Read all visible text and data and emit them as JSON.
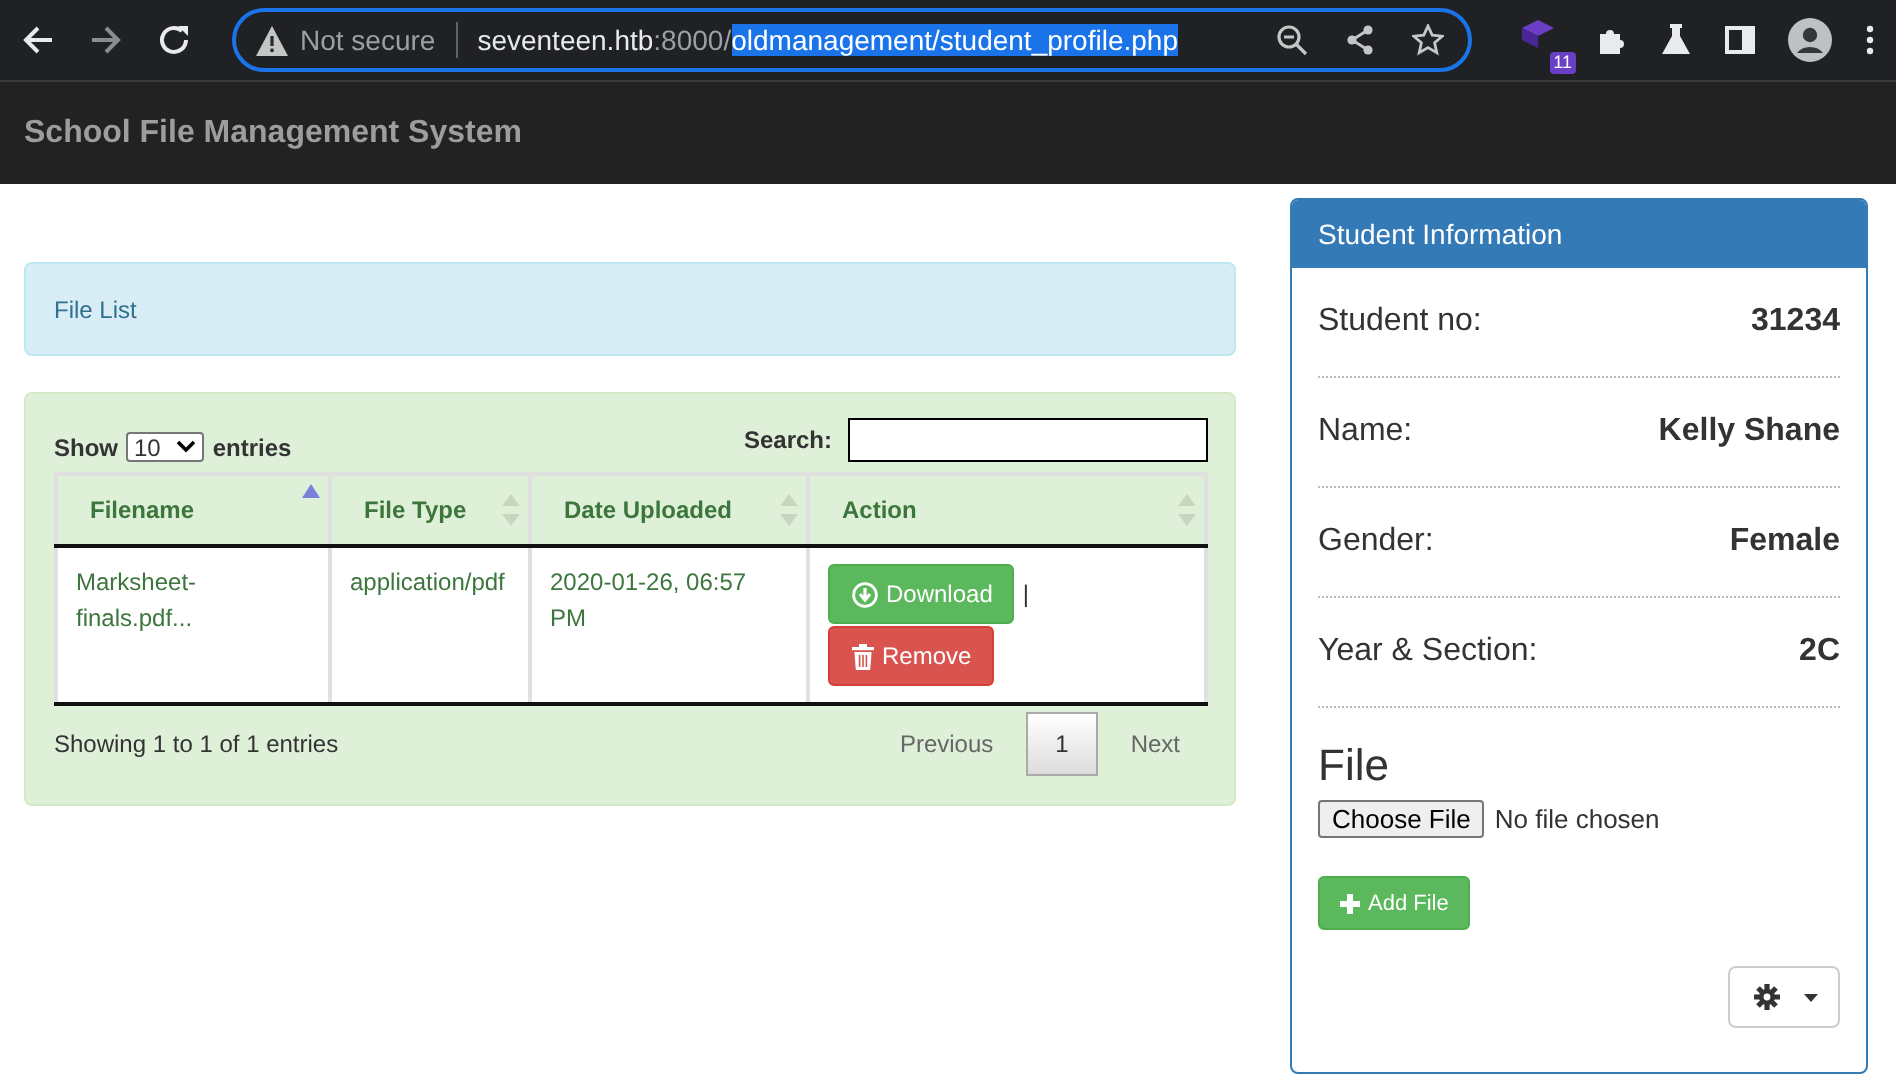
{
  "browser": {
    "security": "Not secure",
    "url": [
      {
        "text": "seventeen.htb",
        "emphasized": true,
        "selected": false
      },
      {
        "text": ":8000/",
        "emphasized": false,
        "selected": false
      },
      {
        "text": "oldmanagement/student_profile.php",
        "emphasized": false,
        "selected": true
      }
    ],
    "extension_badge": "11"
  },
  "navbar": {
    "brand": "School File Management System"
  },
  "file_list": {
    "title": "File List"
  },
  "table": {
    "length": {
      "before": "Show",
      "value": "10",
      "after": "entries"
    },
    "search": {
      "label": "Search:"
    },
    "columns": [
      {
        "label": "Filename",
        "sorted": true
      },
      {
        "label": "File Type",
        "sorted": false
      },
      {
        "label": "Date Uploaded",
        "sorted": false
      },
      {
        "label": "Action",
        "sorted": false
      }
    ],
    "rows": [
      {
        "filename": "Marksheet-finals.pdf...",
        "type": "application/pdf",
        "date": "2020-01-26, 06:57 PM",
        "actions": [
          "Download",
          "Remove"
        ],
        "separator": "|"
      }
    ],
    "info": "Showing 1 to 1 of 1 entries",
    "pagination": [
      {
        "label": "Previous",
        "kind": "nav",
        "disabled": true,
        "selected": false
      },
      {
        "label": "1",
        "kind": "page",
        "disabled": false,
        "selected": true
      },
      {
        "label": "Next",
        "kind": "nav",
        "disabled": true,
        "selected": false
      }
    ]
  },
  "student": {
    "title": "Student Information",
    "fields": [
      {
        "label": "Student no:",
        "value": "31234"
      },
      {
        "label": "Name:",
        "value": "Kelly Shane"
      },
      {
        "label": "Gender:",
        "value": "Female"
      },
      {
        "label": "Year & Section:",
        "value": "2C"
      }
    ],
    "file_heading": "File",
    "choose_button": "Choose File",
    "file_status": "No file chosen",
    "add_button": "Add File"
  }
}
